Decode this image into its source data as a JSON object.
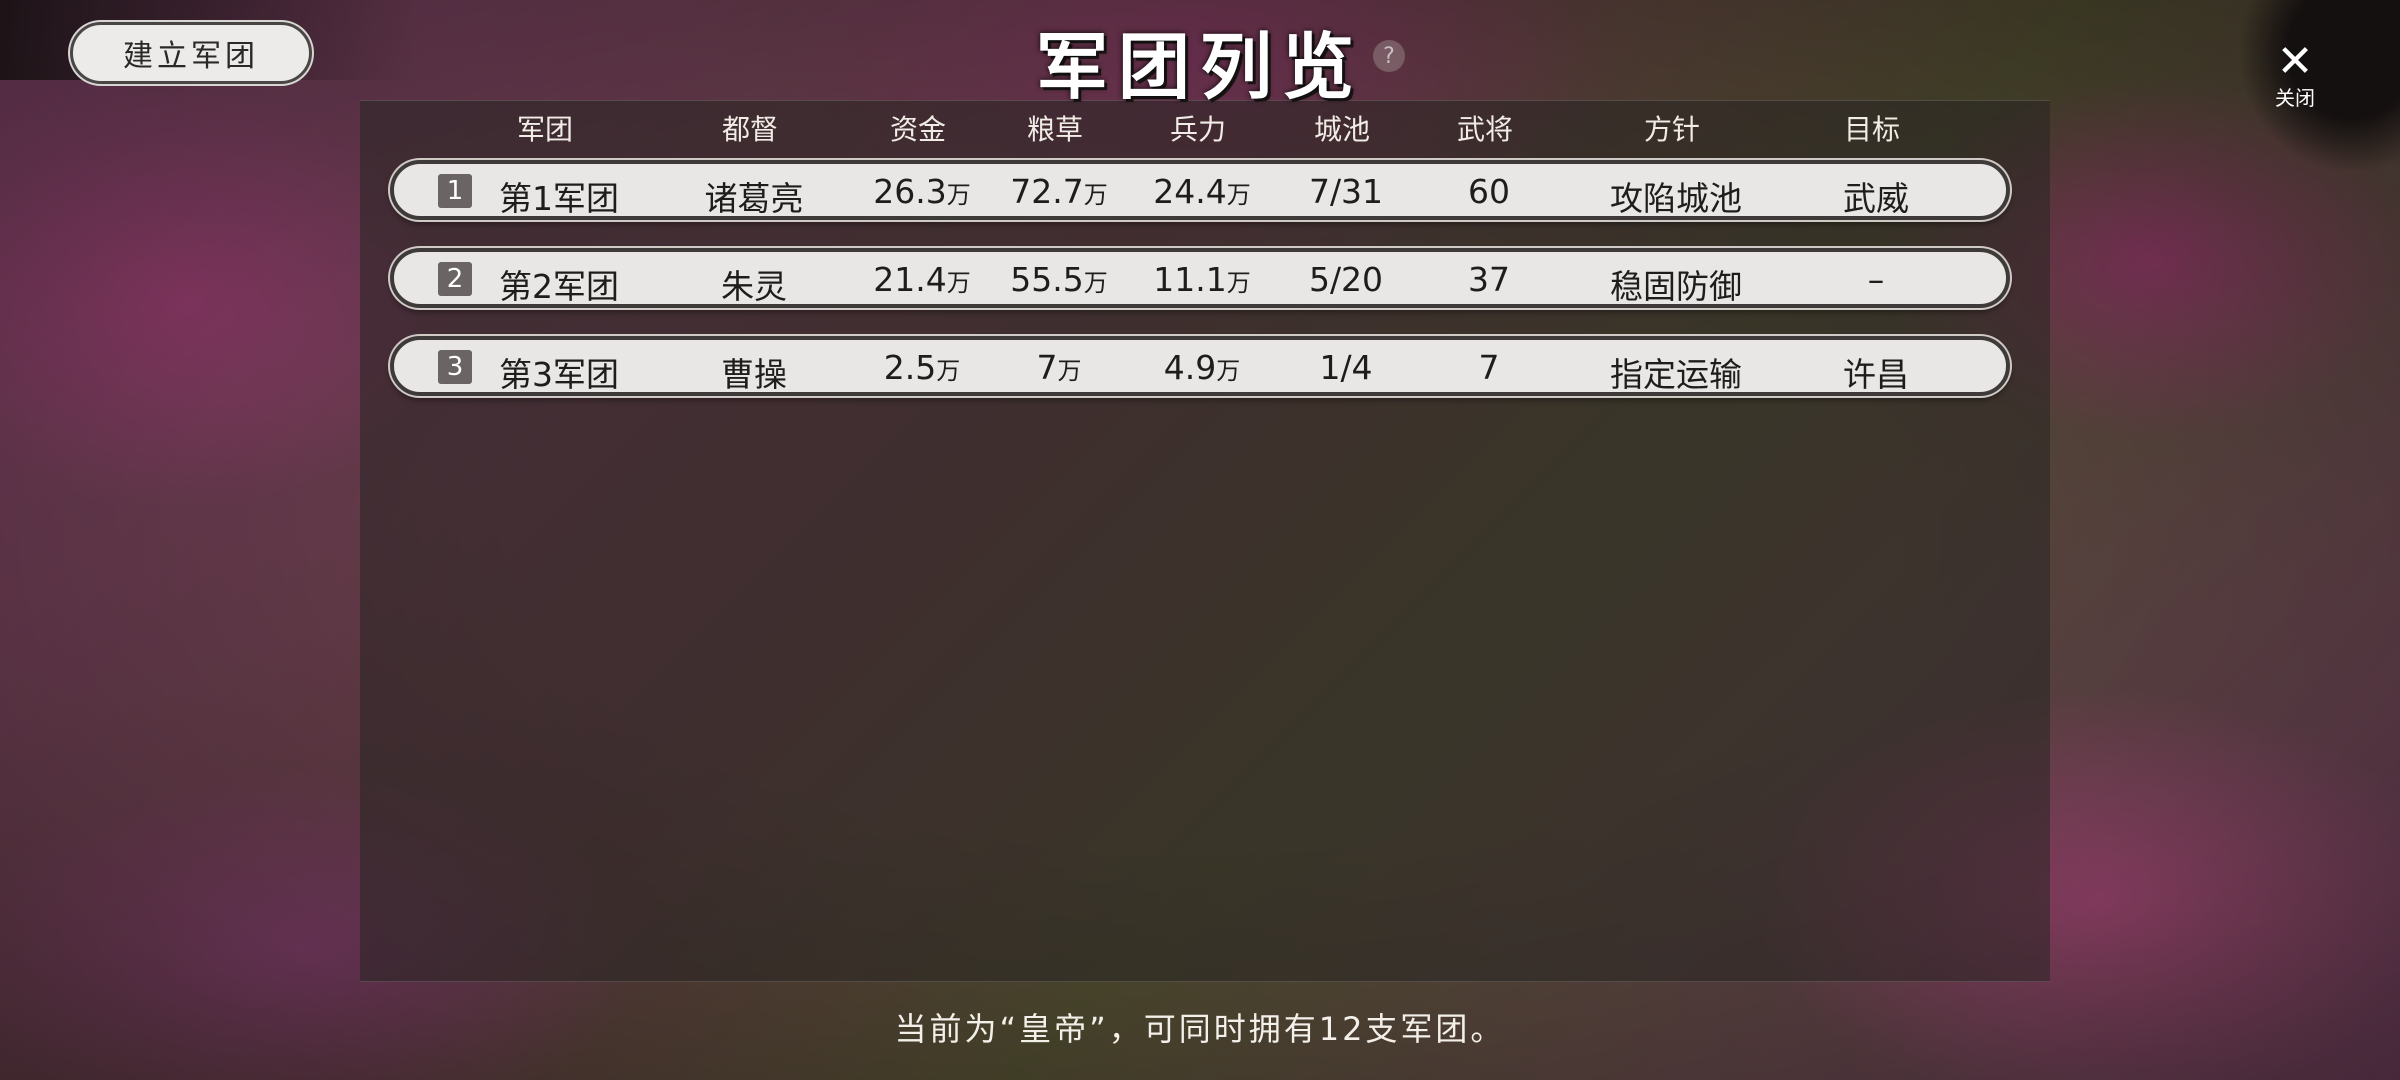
{
  "create_button_label": "建立军团",
  "title": "军团列览",
  "help_icon": "?",
  "close": {
    "icon": "✕",
    "label": "关闭"
  },
  "columns": [
    "军团",
    "都督",
    "资金",
    "粮草",
    "兵力",
    "城池",
    "武将",
    "方针",
    "目标"
  ],
  "unit": "万",
  "rows": [
    {
      "index": "1",
      "name": "第1军团",
      "governor": "诸葛亮",
      "funds": "26.3",
      "food": "72.7",
      "troops": "24.4",
      "cities": "7/31",
      "generals": "60",
      "policy": "攻陷城池",
      "target": "武威"
    },
    {
      "index": "2",
      "name": "第2军团",
      "governor": "朱灵",
      "funds": "21.4",
      "food": "55.5",
      "troops": "11.1",
      "cities": "5/20",
      "generals": "37",
      "policy": "稳固防御",
      "target": "–"
    },
    {
      "index": "3",
      "name": "第3军团",
      "governor": "曹操",
      "funds": "2.5",
      "food": "7",
      "troops": "4.9",
      "cities": "1/4",
      "generals": "7",
      "policy": "指定运输",
      "target": "许昌"
    }
  ],
  "footer": "当前为“皇帝”，可同时拥有12支军团。"
}
